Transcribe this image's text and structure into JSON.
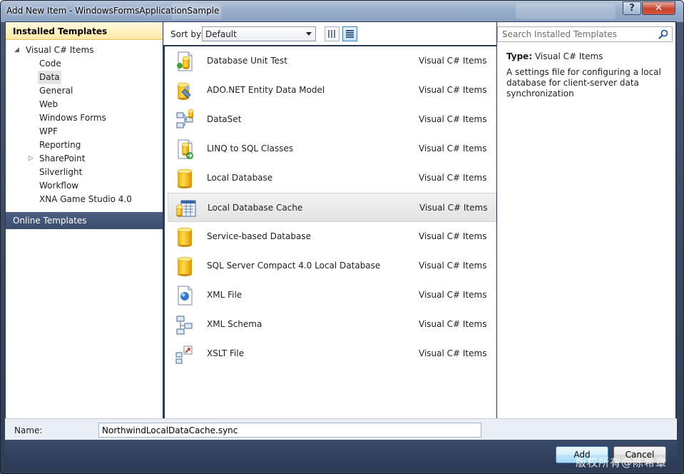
{
  "window": {
    "title": "Add New Item - WindowsFormsApplicationSample",
    "help_label": "?",
    "close_label": "✕"
  },
  "left": {
    "installed_header": "Installed Templates",
    "tree": [
      {
        "label": "Visual C# Items",
        "level": 0,
        "arrow": "◢",
        "selected": false
      },
      {
        "label": "Code",
        "level": 1,
        "arrow": "",
        "selected": false
      },
      {
        "label": "Data",
        "level": 1,
        "arrow": "",
        "selected": true
      },
      {
        "label": "General",
        "level": 1,
        "arrow": "",
        "selected": false
      },
      {
        "label": "Web",
        "level": 1,
        "arrow": "",
        "selected": false
      },
      {
        "label": "Windows Forms",
        "level": 1,
        "arrow": "",
        "selected": false
      },
      {
        "label": "WPF",
        "level": 1,
        "arrow": "",
        "selected": false
      },
      {
        "label": "Reporting",
        "level": 1,
        "arrow": "",
        "selected": false
      },
      {
        "label": "SharePoint",
        "level": 1,
        "arrow": "▷",
        "selected": false
      },
      {
        "label": "Silverlight",
        "level": 1,
        "arrow": "",
        "selected": false
      },
      {
        "label": "Workflow",
        "level": 1,
        "arrow": "",
        "selected": false
      },
      {
        "label": "XNA Game Studio 4.0",
        "level": 1,
        "arrow": "",
        "selected": false
      }
    ],
    "online_header": "Online Templates"
  },
  "toolbar": {
    "sort_label": "Sort by:",
    "sort_value": "Default"
  },
  "templates": [
    {
      "name": "Database Unit Test",
      "category": "Visual C# Items",
      "icon": "database-unit-test-icon",
      "selected": false
    },
    {
      "name": "ADO.NET Entity Data Model",
      "category": "Visual C# Items",
      "icon": "entity-data-model-icon",
      "selected": false
    },
    {
      "name": "DataSet",
      "category": "Visual C# Items",
      "icon": "dataset-icon",
      "selected": false
    },
    {
      "name": "LINQ to SQL Classes",
      "category": "Visual C# Items",
      "icon": "linq-to-sql-icon",
      "selected": false
    },
    {
      "name": "Local Database",
      "category": "Visual C# Items",
      "icon": "database-icon",
      "selected": false
    },
    {
      "name": "Local Database Cache",
      "category": "Visual C# Items",
      "icon": "database-cache-icon",
      "selected": true
    },
    {
      "name": "Service-based Database",
      "category": "Visual C# Items",
      "icon": "database-icon",
      "selected": false
    },
    {
      "name": "SQL Server Compact 4.0 Local Database",
      "category": "Visual C# Items",
      "icon": "database-icon",
      "selected": false
    },
    {
      "name": "XML File",
      "category": "Visual C# Items",
      "icon": "xml-file-icon",
      "selected": false
    },
    {
      "name": "XML Schema",
      "category": "Visual C# Items",
      "icon": "xml-schema-icon",
      "selected": false
    },
    {
      "name": "XSLT File",
      "category": "Visual C# Items",
      "icon": "xslt-file-icon",
      "selected": false
    }
  ],
  "details": {
    "search_placeholder": "Search Installed Templates",
    "type_label": "Type:",
    "type_value": "Visual C# Items",
    "description": "A settings file for configuring a local database for client-server data synchronization"
  },
  "bottom": {
    "name_label": "Name:",
    "name_value": "NorthwindLocalDataCache.sync",
    "add_label": "Add",
    "cancel_label": "Cancel",
    "watermark": "版权所有@陈希章"
  }
}
